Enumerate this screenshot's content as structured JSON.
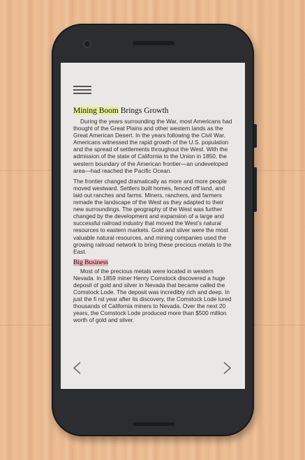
{
  "article": {
    "title_highlight": "Mining Boom",
    "title_rest": " Brings Growth",
    "paragraphs": [
      "During the years surrounding the War, most Americans had thought of the Great Plains and other western lands as the Great American Desert. In the years following the Civil War, Americans witnessed the rapid growth of the U.S. population and the spread of settlements throughout the West. With the admission of the state of California to the Union in 1850, the western boundary of the American frontier—an undeveloped area—had reached the Pacific Ocean.",
      "The frontier changed dramatically as more and more people moved westward. Settlers built homes, fenced off land, and laid out ranches and farms. Miners, ranchers, and farmers remade the landscape of the West as they adapted to their new surroundings. The geography of the West was further changed by the development and expansion of a large and successful railroad industry that moved the West’s natural resources to eastern markets. Gold and silver were the most valuable natural resources, and mining companies used the growing railroad network to bring these precious metals to the East."
    ],
    "subheading": "Big Business",
    "sub_paragraph": "Most of the precious metals were located in western Nevada. In 1859 miner Henry Comstock discovered a huge deposit of gold and silver in Nevada that became called the Comstock Lode. The deposit was incredibly rich and deep. In just the fi rst year after its discovery, the Comstock Lode lured thousands of California miners to Nevada. Over the next 20 years, the Comstock Lode produced more than $500 million worth of gold and silver."
  },
  "navigation": {
    "prev_icon": "chevron-left-icon",
    "next_icon": "chevron-right-icon",
    "menu_icon": "hamburger-menu-icon"
  },
  "colors": {
    "highlight_yellow": "#e7ef9a",
    "highlight_pink": "#efb3bd",
    "phone_body": "#2c2d30",
    "screen_bg": "#e9e8e6"
  }
}
